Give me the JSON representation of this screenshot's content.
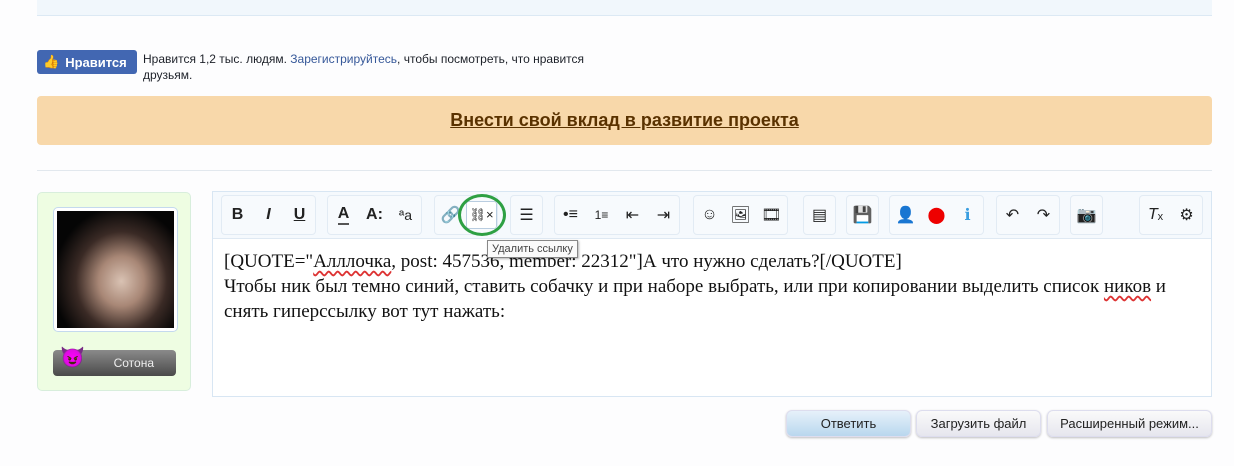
{
  "facebook": {
    "like_label": "Нравится",
    "count_text": "Нравится 1,2 тыс. людям.",
    "register_link": "Зарегистрируйтесь",
    "rest_text": ", чтобы посмотреть, что нравится друзьям."
  },
  "banner": {
    "link": "Внести свой вклад в развитие проекта"
  },
  "user": {
    "rank": "Сотона"
  },
  "toolbar": {
    "tooltip": "Удалить ссылку",
    "items": [
      "bold",
      "italic",
      "underline",
      "font-color",
      "font-size",
      "font-family",
      "link",
      "unlink",
      "align",
      "bullet-list",
      "numbered-list",
      "outdent",
      "indent",
      "smilies",
      "image",
      "media",
      "insert",
      "save",
      "user",
      "alert",
      "info",
      "undo",
      "redo",
      "camera",
      "remove-format",
      "bbcode"
    ]
  },
  "editor": {
    "line1_a": "[QUOTE=\"",
    "line1_name": "Алллочка",
    "line1_b": ", post: 457536, member: 22312\"]А что нужно сделать?[/QUOTE]",
    "line2": "Чтобы ник был темно синий, ставить собачку и при наборе выбрать, или при копировании выделить список ",
    "line2_sp": "ников",
    "line2_end": " и снять гиперссылку вот тут нажать:"
  },
  "buttons": {
    "reply": "Ответить",
    "upload": "Загрузить файл",
    "advanced": "Расширенный режим..."
  }
}
